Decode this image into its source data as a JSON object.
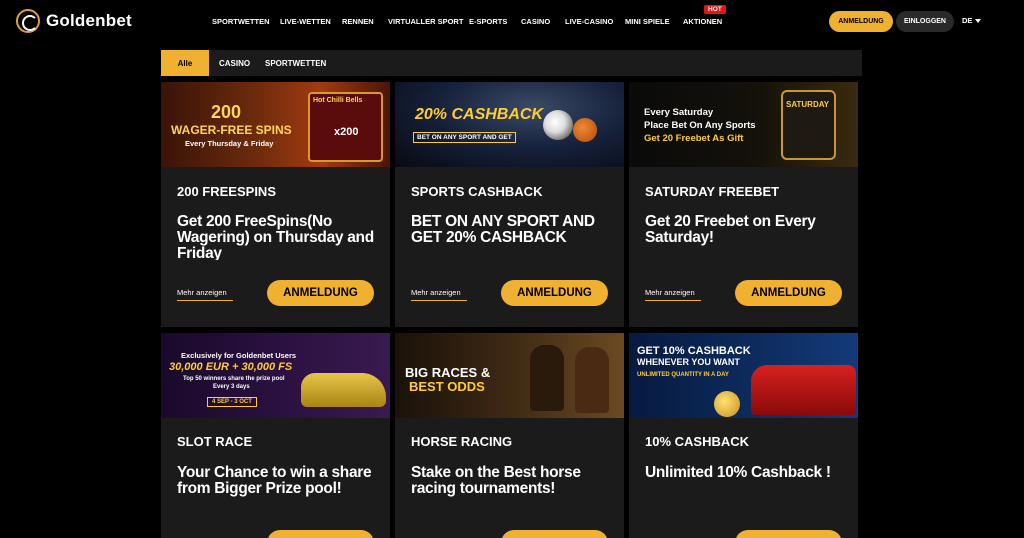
{
  "header": {
    "logo_text": "Goldenbet",
    "nav": [
      "SPORTWETTEN",
      "LIVE-WETTEN",
      "RENNEN",
      "VIRTUALLER SPORT",
      "E-SPORTS",
      "CASINO",
      "LIVE-CASINO",
      "MINI SPIELE",
      "AKTIONEN"
    ],
    "hot_badge": "HOT",
    "register_label": "ANMELDUNG",
    "login_label": "EINLOGGEN",
    "language": "DE"
  },
  "filters": [
    "Alle",
    "CASINO",
    "SPORTWETTEN"
  ],
  "cards": [
    {
      "banner_lines": [
        "200",
        "WAGER-FREE SPINS",
        "Every Thursday & Friday",
        "Hot Chilli Bells",
        "x200"
      ],
      "title": "200 FREESPINS",
      "desc": "Get 200 FreeSpins(No Wagering) on Thursday and Friday",
      "more": "Mehr anzeigen",
      "button": "ANMELDUNG"
    },
    {
      "banner_lines": [
        "20% CASHBACK",
        "BET ON ANY SPORT AND GET"
      ],
      "title": "SPORTS CASHBACK",
      "desc": "BET ON ANY SPORT AND GET 20% CASHBACK",
      "more": "Mehr anzeigen",
      "button": "ANMELDUNG"
    },
    {
      "banner_lines": [
        "Every Saturday",
        "Place Bet On Any Sports",
        "Get 20 Freebet As Gift",
        "SATURDAY"
      ],
      "title": "SATURDAY FREEBET",
      "desc": "Get 20 Freebet on Every Saturday!",
      "more": "Mehr anzeigen",
      "button": "ANMELDUNG"
    },
    {
      "banner_lines": [
        "Exclusively for Goldenbet Users",
        "30,000 EUR + 30,000 FS",
        "Top 50 winners share the prize pool",
        "Every 3 days",
        "4 SEP - 3 OCT"
      ],
      "title": "SLOT RACE",
      "desc": "Your Chance to win a share from Bigger Prize pool!",
      "more": "",
      "button": ""
    },
    {
      "banner_lines": [
        "BIG RACES &",
        "BEST ODDS"
      ],
      "title": "HORSE RACING",
      "desc": "Stake on the Best horse racing tournaments!",
      "more": "",
      "button": ""
    },
    {
      "banner_lines": [
        "GET 10% CASHBACK",
        "WHENEVER YOU WANT",
        "UNLIMITED QUANTITY IN A DAY"
      ],
      "title": "10% CASHBACK",
      "desc": "Unlimited 10% Cashback !",
      "more": "",
      "button": ""
    }
  ],
  "colors": {
    "accent": "#f0b030",
    "card_bg": "#1b1b1b",
    "page_bg": "#000000",
    "hot": "#e01818"
  }
}
